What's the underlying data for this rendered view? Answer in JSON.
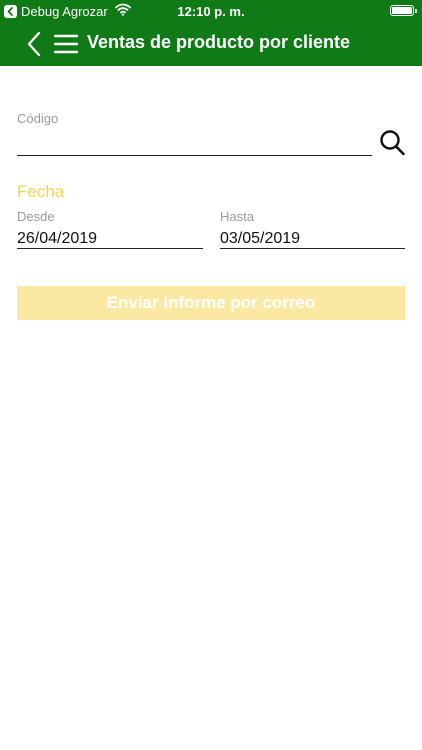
{
  "status_bar": {
    "carrier": "Debug Agrozar",
    "time": "12:10 p. m.",
    "battery_level": 1.0
  },
  "nav": {
    "title": "Ventas de producto por cliente",
    "back_icon": "chevron-left-icon",
    "menu_icon": "hamburger-menu-icon"
  },
  "form": {
    "code_label": "Código",
    "code_value": "",
    "search_icon": "search-icon",
    "date_section_title": "Fecha",
    "from_label": "Desde",
    "from_value": "26/04/2019",
    "to_label": "Hasta",
    "to_value": "03/05/2019",
    "submit_label": "Enviar informe por correo"
  },
  "colors": {
    "primary": "#0f7a16",
    "accent": "#f2d64b",
    "button_disabled": "#fbe9a3"
  }
}
